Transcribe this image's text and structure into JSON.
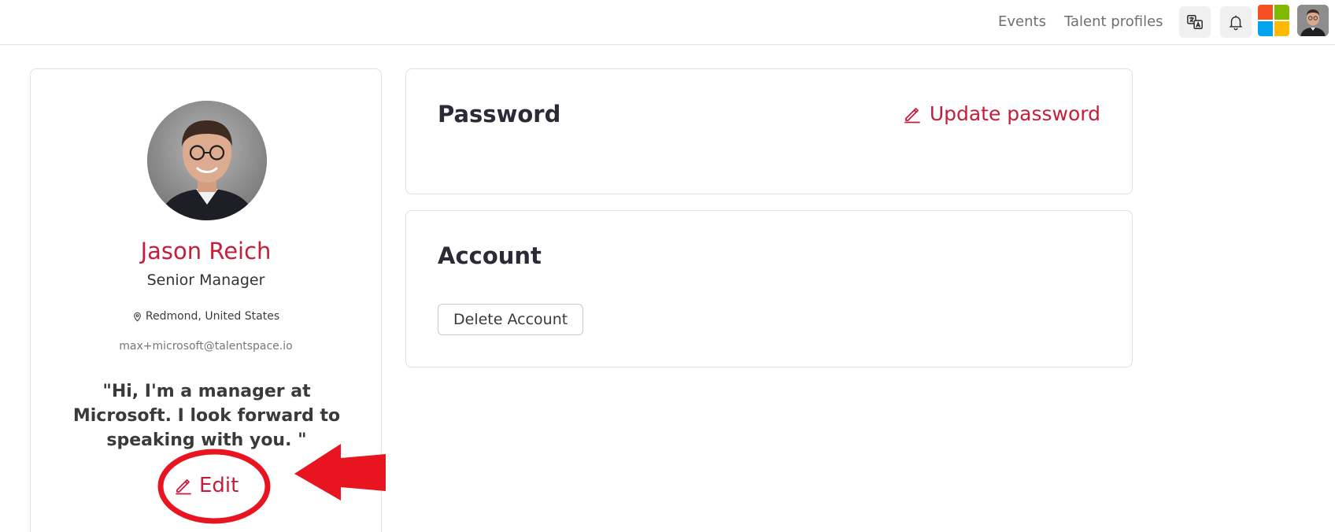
{
  "topnav": {
    "events_label": "Events",
    "talent_label": "Talent profiles"
  },
  "icons": {
    "translate": "translate-icon",
    "bell": "bell-icon",
    "pencil": "pencil-icon",
    "location": "location-pin-icon"
  },
  "colors": {
    "accent": "#c41e3a",
    "annotation": "#e8141f",
    "ms_red": "#f25022",
    "ms_green": "#7fba00",
    "ms_blue": "#00a4ef",
    "ms_yellow": "#ffb900"
  },
  "profile": {
    "name": "Jason Reich",
    "role": "Senior Manager",
    "location": "Redmond, United States",
    "email": "max+microsoft@talentspace.io",
    "bio": "\"Hi, I'm a manager at Microsoft. I look forward to speaking with you. \"",
    "edit_label": "Edit"
  },
  "password_section": {
    "title": "Password",
    "update_label": "Update password"
  },
  "account_section": {
    "title": "Account",
    "delete_label": "Delete Account"
  }
}
